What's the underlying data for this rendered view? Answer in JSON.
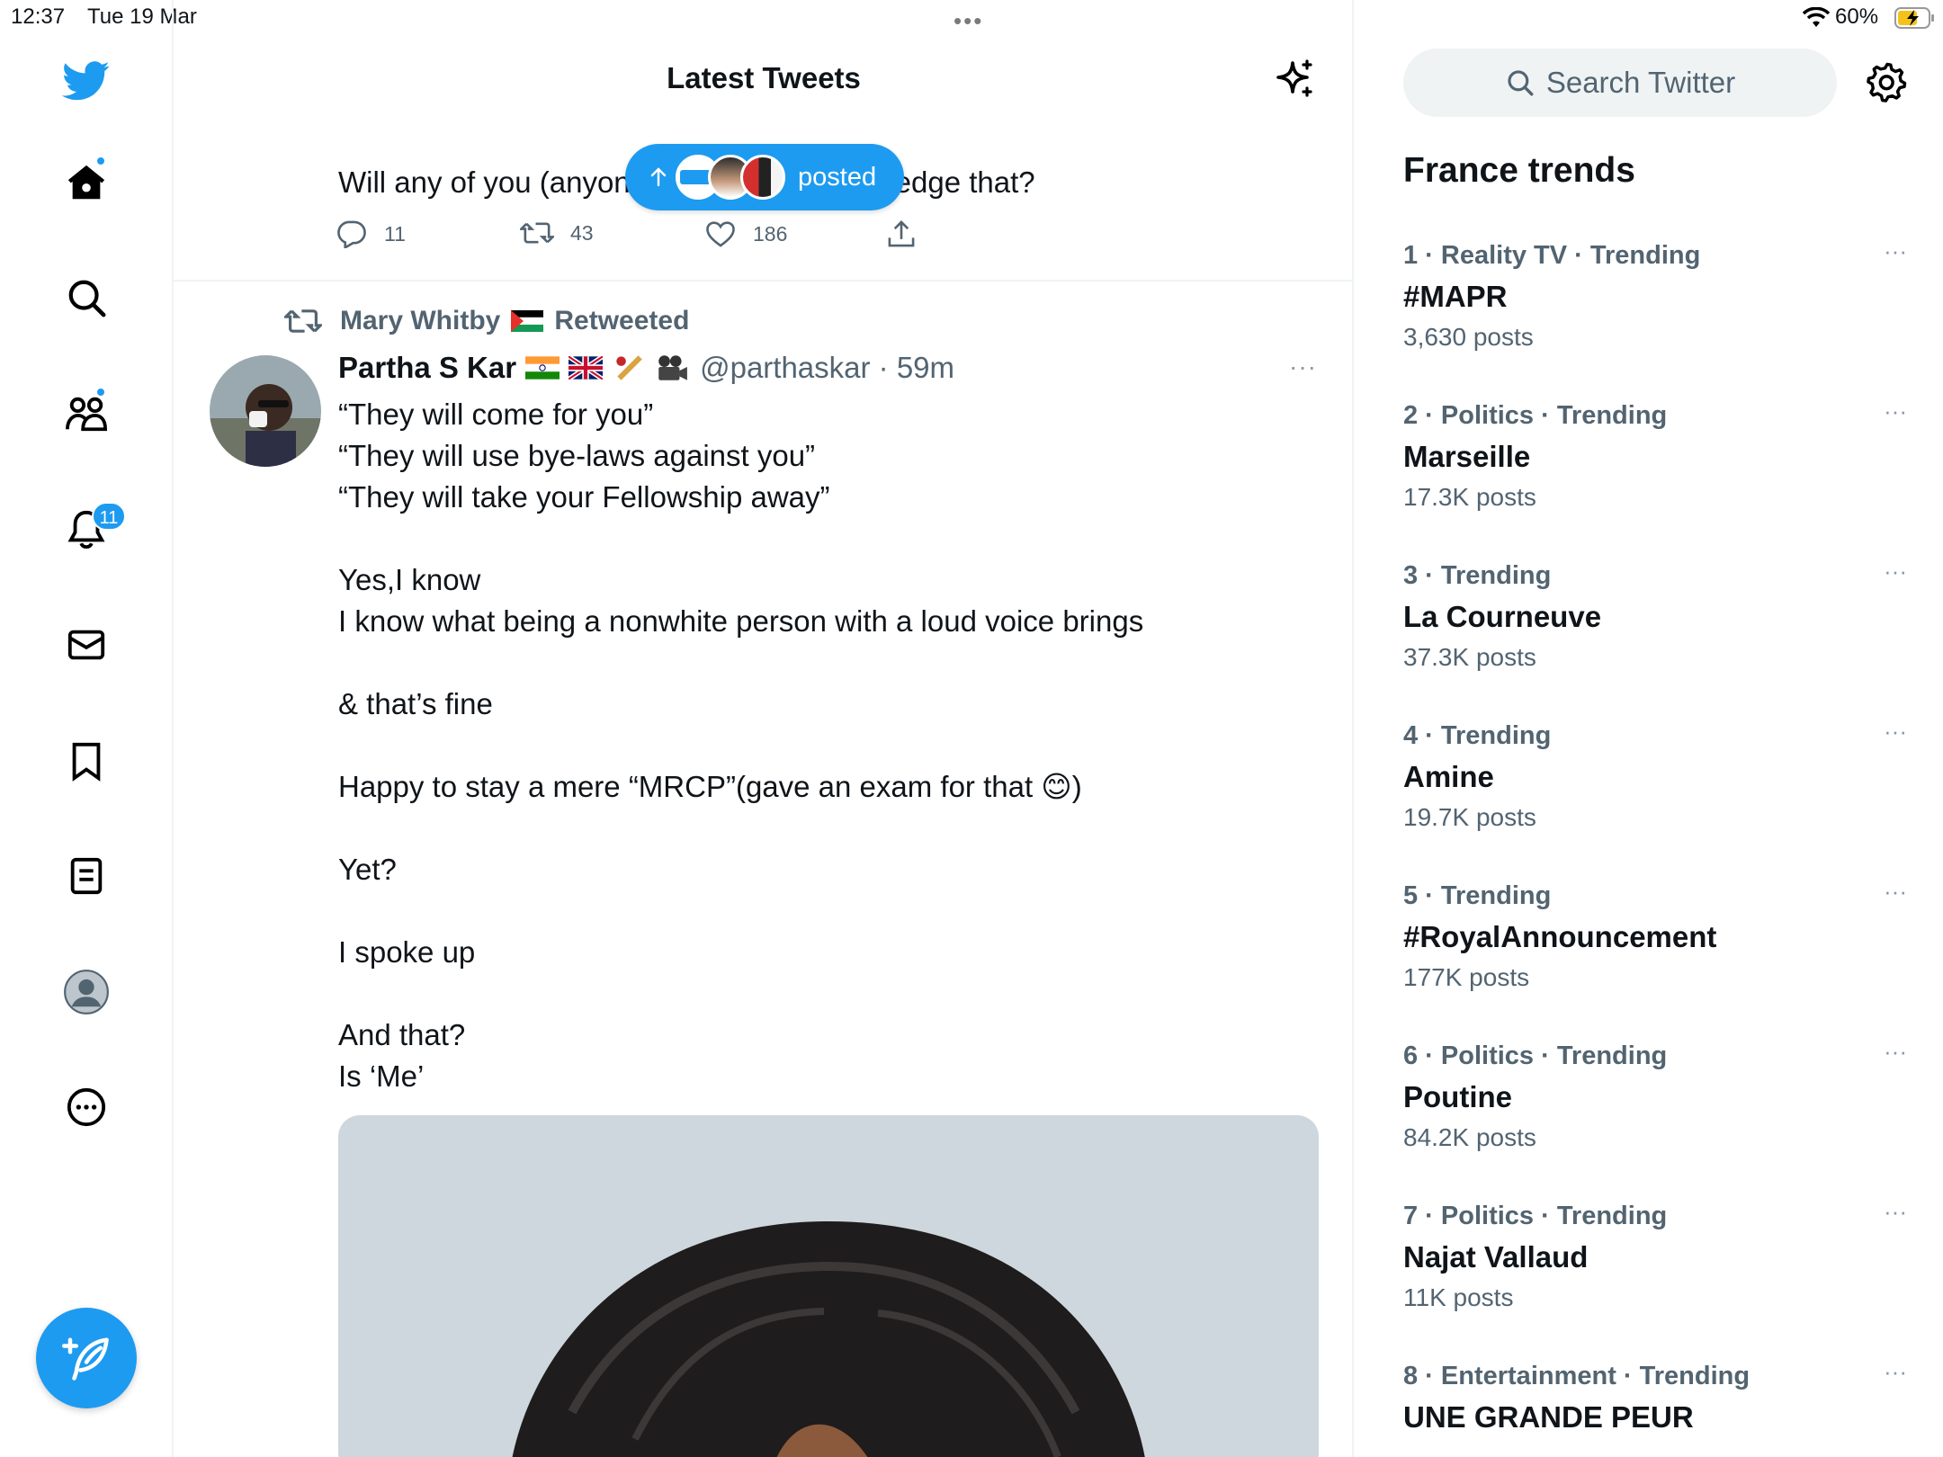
{
  "status_bar": {
    "time": "12:37",
    "date": "Tue 19 Mar",
    "battery": "60%",
    "dots": "•••"
  },
  "nav": {
    "notifications_badge": "11",
    "items": [
      "twitter-logo",
      "home",
      "search",
      "communities",
      "notifications",
      "messages",
      "bookmarks",
      "lists",
      "profile",
      "more"
    ]
  },
  "timeline": {
    "title": "Latest Tweets",
    "prev_tweet": {
      "text_left": "Will any of you (anyon",
      "text_right": "edge that?",
      "replies": "11",
      "retweets": "43",
      "likes": "186"
    },
    "new_posts_pill": {
      "label": "posted"
    },
    "tweet": {
      "retweeted_by": "Mary Whitby",
      "retweeted_label": "Retweeted",
      "author": "Partha S Kar",
      "handle": "@parthaskar · 59m",
      "more": "···",
      "lines": [
        "“They will come for you”",
        "“They will use bye-laws against you”",
        "“They will take your Fellowship away”",
        "",
        "Yes,I know",
        "I know what being a nonwhite person with a loud voice brings",
        "",
        "& that’s fine",
        "",
        "Happy to stay a mere “MRCP”(gave an exam for that 😊)",
        "",
        "Yet?",
        "",
        "I spoke up",
        "",
        "And that?",
        "Is ‘Me’"
      ]
    }
  },
  "search": {
    "placeholder": "Search Twitter"
  },
  "trends": {
    "title": "France trends",
    "items": [
      {
        "meta": "1 · Reality TV · Trending",
        "name": "#MAPR",
        "count": "3,630 posts"
      },
      {
        "meta": "2 · Politics · Trending",
        "name": "Marseille",
        "count": "17.3K posts"
      },
      {
        "meta": "3 · Trending",
        "name": "La Courneuve",
        "count": "37.3K posts"
      },
      {
        "meta": "4 · Trending",
        "name": "Amine",
        "count": "19.7K posts"
      },
      {
        "meta": "5 · Trending",
        "name": "#RoyalAnnouncement",
        "count": "177K posts"
      },
      {
        "meta": "6 · Politics · Trending",
        "name": "Poutine",
        "count": "84.2K posts"
      },
      {
        "meta": "7 · Politics · Trending",
        "name": "Najat Vallaud",
        "count": "11K posts"
      },
      {
        "meta": "8 · Entertainment · Trending",
        "name": "UNE GRANDE PEUR",
        "count": ""
      }
    ],
    "more": "···"
  },
  "colors": {
    "accent": "#1d9bf0",
    "secondary_text": "#536471",
    "border": "#eff3f4"
  }
}
